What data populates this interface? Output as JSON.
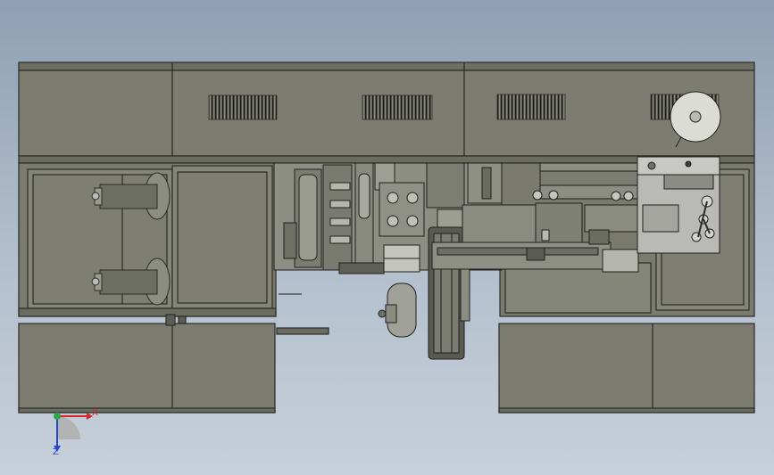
{
  "viewport": {
    "background_top": "#8fa0b4",
    "background_bottom": "#c7d0da",
    "panel_color": "#7c7d70",
    "panel_light": "#8a8b7e",
    "edge_color": "#2b2c28",
    "vent_color": "#1c1d1a"
  },
  "triad": {
    "x_label": "X",
    "z_label": "Z",
    "x_color": "#d8262a",
    "y_color": "#2ea84a",
    "z_color": "#2846c8"
  }
}
